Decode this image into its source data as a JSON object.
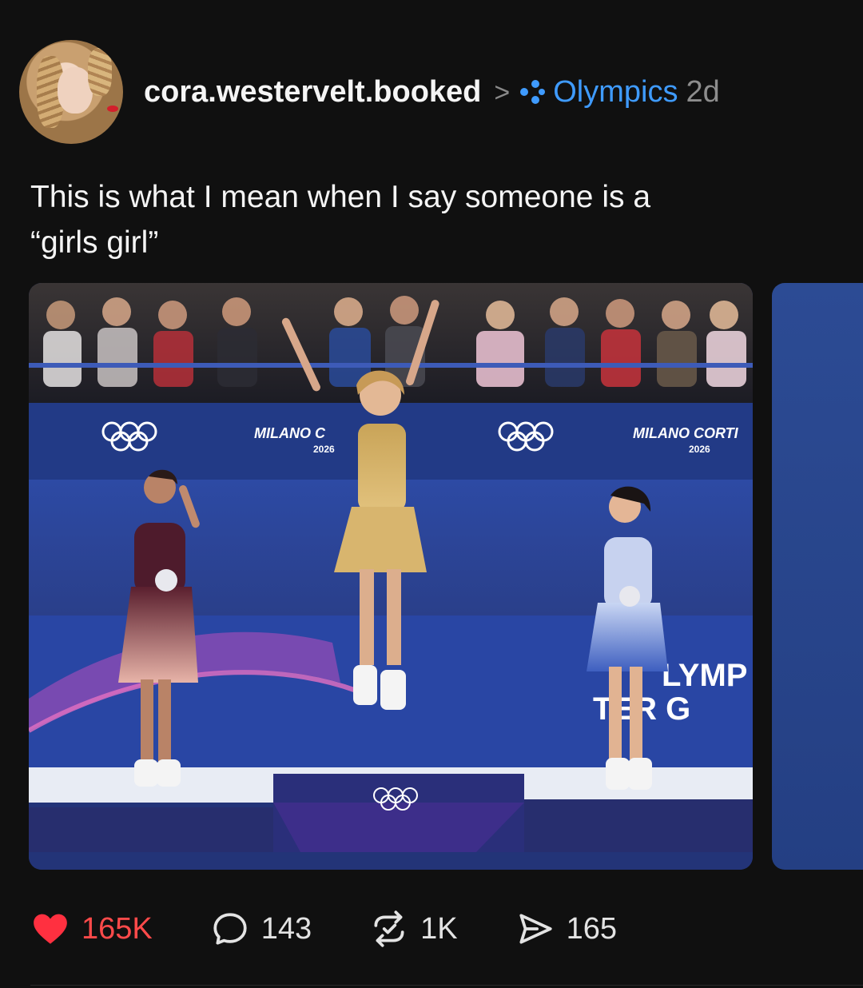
{
  "header": {
    "username": "cora.westervelt.booked",
    "separator": ">",
    "topic": "Olympics",
    "age": "2d"
  },
  "post": {
    "text_line1": "This is what I mean when I say someone is a",
    "text_line2": "“girls girl”"
  },
  "photo": {
    "banner_left": "MILANO C",
    "banner_left_year": "2026",
    "banner_right": "MILANO CORTI",
    "banner_right_year": "2026",
    "board_line1": "LYMP",
    "board_line2": "TER G"
  },
  "actions": {
    "likes": "165K",
    "replies": "143",
    "reposts": "1K",
    "shares": "165"
  },
  "colors": {
    "background": "#101010",
    "topic_link": "#3f9bff",
    "like_red": "#ff4a4a"
  }
}
